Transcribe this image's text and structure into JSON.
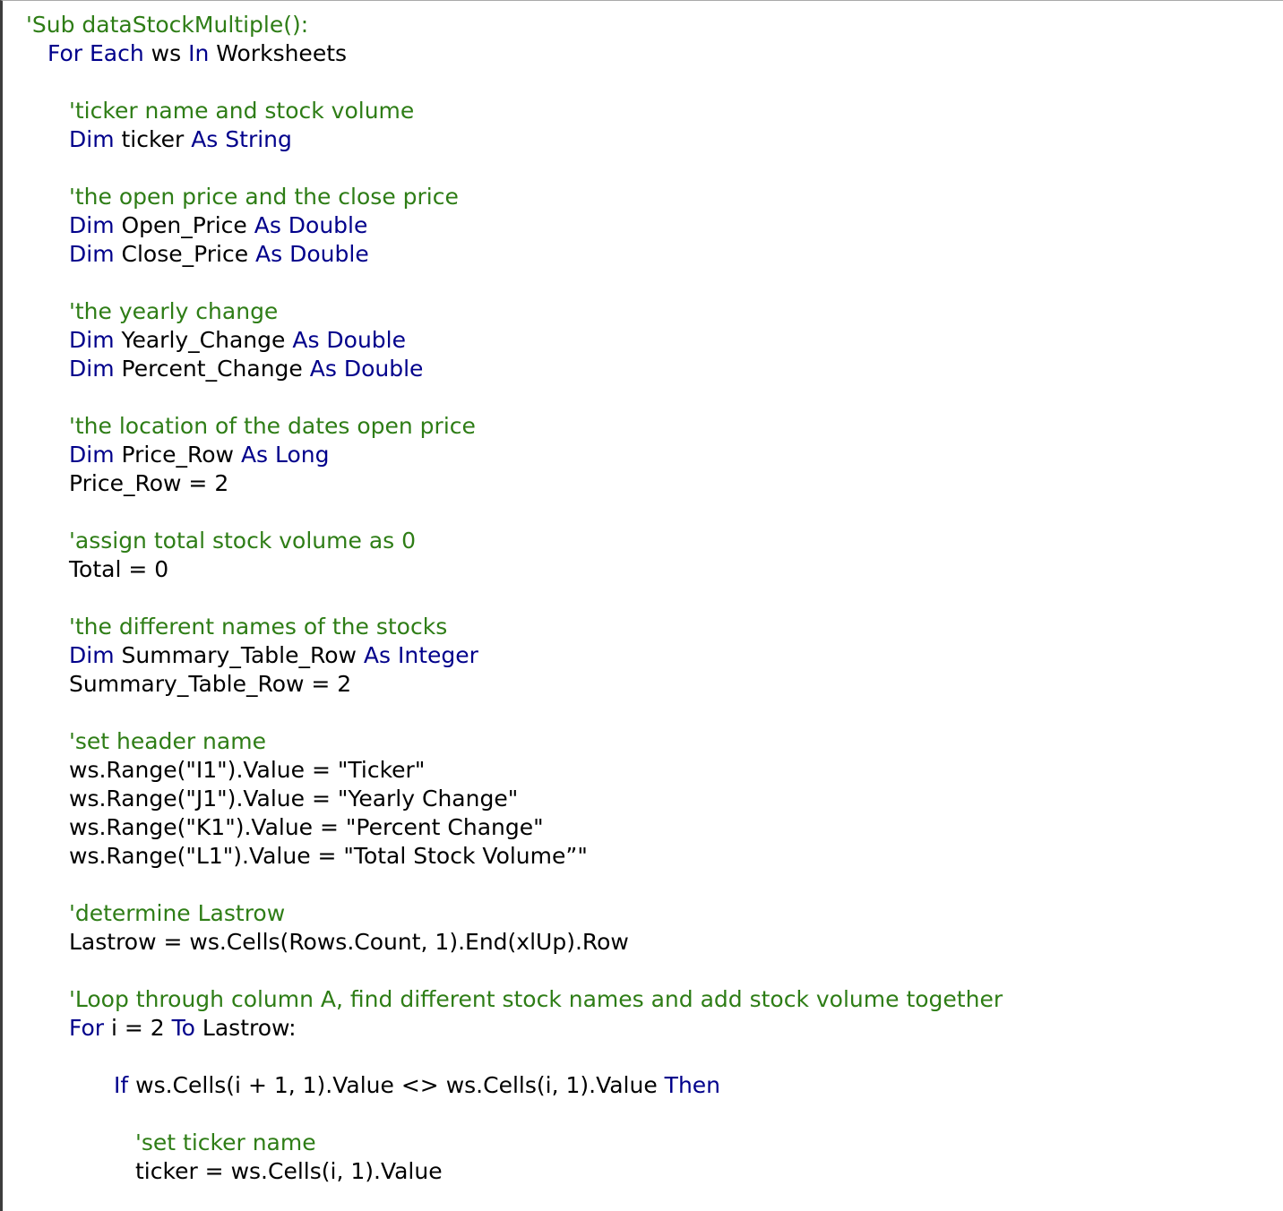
{
  "editor": {
    "colors": {
      "keyword": "#00008b",
      "comment": "#2e7d16",
      "text": "#000000",
      "background": "#ffffff"
    },
    "lines": [
      {
        "indent": 1,
        "tokens": [
          {
            "t": "'Sub dataStockMultiple():",
            "k": "cm"
          }
        ]
      },
      {
        "indent": 2,
        "tokens": [
          {
            "t": "For Each",
            "k": "kw"
          },
          {
            "t": " ws ",
            "k": "tx"
          },
          {
            "t": "In",
            "k": "kw"
          },
          {
            "t": " Worksheets",
            "k": "tx"
          }
        ]
      },
      {
        "indent": 0,
        "tokens": []
      },
      {
        "indent": 3,
        "tokens": [
          {
            "t": "'ticker name and stock volume",
            "k": "cm"
          }
        ]
      },
      {
        "indent": 3,
        "tokens": [
          {
            "t": "Dim",
            "k": "kw"
          },
          {
            "t": " ticker ",
            "k": "tx"
          },
          {
            "t": "As String",
            "k": "kw"
          }
        ]
      },
      {
        "indent": 0,
        "tokens": []
      },
      {
        "indent": 3,
        "tokens": [
          {
            "t": "'the open price and the close price",
            "k": "cm"
          }
        ]
      },
      {
        "indent": 3,
        "tokens": [
          {
            "t": "Dim",
            "k": "kw"
          },
          {
            "t": " Open_Price ",
            "k": "tx"
          },
          {
            "t": "As Double",
            "k": "kw"
          }
        ]
      },
      {
        "indent": 3,
        "tokens": [
          {
            "t": "Dim",
            "k": "kw"
          },
          {
            "t": " Close_Price ",
            "k": "tx"
          },
          {
            "t": "As Double",
            "k": "kw"
          }
        ]
      },
      {
        "indent": 0,
        "tokens": []
      },
      {
        "indent": 3,
        "tokens": [
          {
            "t": "'the yearly change",
            "k": "cm"
          }
        ]
      },
      {
        "indent": 3,
        "tokens": [
          {
            "t": "Dim",
            "k": "kw"
          },
          {
            "t": " Yearly_Change ",
            "k": "tx"
          },
          {
            "t": "As Double",
            "k": "kw"
          }
        ]
      },
      {
        "indent": 3,
        "tokens": [
          {
            "t": "Dim",
            "k": "kw"
          },
          {
            "t": " Percent_Change ",
            "k": "tx"
          },
          {
            "t": "As Double",
            "k": "kw"
          }
        ]
      },
      {
        "indent": 0,
        "tokens": []
      },
      {
        "indent": 3,
        "tokens": [
          {
            "t": "'the location of the dates open price",
            "k": "cm"
          }
        ]
      },
      {
        "indent": 3,
        "tokens": [
          {
            "t": "Dim",
            "k": "kw"
          },
          {
            "t": " Price_Row ",
            "k": "tx"
          },
          {
            "t": "As Long",
            "k": "kw"
          }
        ]
      },
      {
        "indent": 3,
        "tokens": [
          {
            "t": "Price_Row = 2",
            "k": "tx"
          }
        ]
      },
      {
        "indent": 0,
        "tokens": []
      },
      {
        "indent": 3,
        "tokens": [
          {
            "t": "'assign total stock volume as 0",
            "k": "cm"
          }
        ]
      },
      {
        "indent": 3,
        "tokens": [
          {
            "t": "Total = 0",
            "k": "tx"
          }
        ]
      },
      {
        "indent": 0,
        "tokens": []
      },
      {
        "indent": 3,
        "tokens": [
          {
            "t": "'the different names of the stocks",
            "k": "cm"
          }
        ]
      },
      {
        "indent": 3,
        "tokens": [
          {
            "t": "Dim",
            "k": "kw"
          },
          {
            "t": " Summary_Table_Row ",
            "k": "tx"
          },
          {
            "t": "As Integer",
            "k": "kw"
          }
        ]
      },
      {
        "indent": 3,
        "tokens": [
          {
            "t": "Summary_Table_Row = 2",
            "k": "tx"
          }
        ]
      },
      {
        "indent": 0,
        "tokens": []
      },
      {
        "indent": 3,
        "tokens": [
          {
            "t": "'set header name",
            "k": "cm"
          }
        ]
      },
      {
        "indent": 3,
        "tokens": [
          {
            "t": "ws.Range(\"I1\").Value = \"Ticker\"",
            "k": "tx"
          }
        ]
      },
      {
        "indent": 3,
        "tokens": [
          {
            "t": "ws.Range(\"J1\").Value = \"Yearly Change\"",
            "k": "tx"
          }
        ]
      },
      {
        "indent": 3,
        "tokens": [
          {
            "t": "ws.Range(\"K1\").Value = \"Percent Change\"",
            "k": "tx"
          }
        ]
      },
      {
        "indent": 3,
        "tokens": [
          {
            "t": "ws.Range(\"L1\").Value = \"Total Stock Volume”\"",
            "k": "tx"
          }
        ]
      },
      {
        "indent": 0,
        "tokens": []
      },
      {
        "indent": 3,
        "tokens": [
          {
            "t": "'determine Lastrow",
            "k": "cm"
          }
        ]
      },
      {
        "indent": 3,
        "tokens": [
          {
            "t": "Lastrow = ws.Cells(Rows.Count, 1).End(xlUp).Row",
            "k": "tx"
          }
        ]
      },
      {
        "indent": 0,
        "tokens": []
      },
      {
        "indent": 3,
        "tokens": [
          {
            "t": "'Loop through column A, find different stock names and add stock volume together",
            "k": "cm"
          }
        ]
      },
      {
        "indent": 3,
        "tokens": [
          {
            "t": "For",
            "k": "kw"
          },
          {
            "t": " i = 2 ",
            "k": "tx"
          },
          {
            "t": "To",
            "k": "kw"
          },
          {
            "t": " Lastrow:",
            "k": "tx"
          }
        ]
      },
      {
        "indent": 0,
        "tokens": []
      },
      {
        "indent": 4,
        "tokens": [
          {
            "t": "If",
            "k": "kw"
          },
          {
            "t": " ws.Cells(i + 1, 1).Value <> ws.Cells(i, 1).Value ",
            "k": "tx"
          },
          {
            "t": "Then",
            "k": "kw"
          }
        ]
      },
      {
        "indent": 0,
        "tokens": []
      },
      {
        "indent": 5,
        "tokens": [
          {
            "t": "'set ticker name",
            "k": "cm"
          }
        ]
      },
      {
        "indent": 5,
        "tokens": [
          {
            "t": "ticker = ws.Cells(i, 1).Value",
            "k": "tx"
          }
        ]
      }
    ]
  }
}
